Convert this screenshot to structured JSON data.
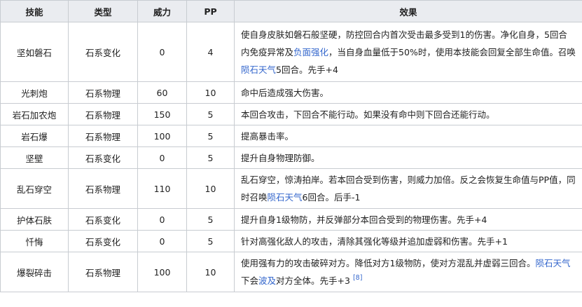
{
  "table": {
    "headers": [
      "技能",
      "类型",
      "威力",
      "PP",
      "效果"
    ],
    "rows": [
      {
        "name": "坚如磐石",
        "type": "石系变化",
        "power": "0",
        "pp": "4",
        "effect": [
          {
            "t": "使自身皮肤如磐石般坚硬，防控回合内首次受击最多受到1的伤害。净化自身，5回合内免疫异常及"
          },
          {
            "t": "负面强化",
            "link": true
          },
          {
            "t": "，当自身血量低于50%时，使用本技能会回复全部生命值。召唤"
          },
          {
            "t": "陨石天气",
            "link": true
          },
          {
            "t": "5回合。先手+4"
          }
        ]
      },
      {
        "name": "光刺炮",
        "type": "石系物理",
        "power": "60",
        "pp": "10",
        "effect": [
          {
            "t": "命中后造成强大伤害。"
          }
        ]
      },
      {
        "name": "岩石加农炮",
        "type": "石系物理",
        "power": "150",
        "pp": "5",
        "effect": [
          {
            "t": "本回合攻击，下回合不能行动。如果没有命中则下回合还能行动。"
          }
        ]
      },
      {
        "name": "岩石爆",
        "type": "石系物理",
        "power": "100",
        "pp": "5",
        "effect": [
          {
            "t": "提高暴击率。"
          }
        ]
      },
      {
        "name": "坚壁",
        "type": "石系变化",
        "power": "0",
        "pp": "5",
        "effect": [
          {
            "t": "提升自身物理防御。"
          }
        ]
      },
      {
        "name": "乱石穿空",
        "type": "石系物理",
        "power": "110",
        "pp": "10",
        "effect": [
          {
            "t": "乱石穿空，惊涛拍岸。若本回合受到伤害，则威力加倍。反之会恢复生命值与PP值，同时召唤"
          },
          {
            "t": "陨石天气",
            "link": true
          },
          {
            "t": "6回合。后手-1"
          }
        ]
      },
      {
        "name": "护体石肤",
        "type": "石系变化",
        "power": "0",
        "pp": "5",
        "effect": [
          {
            "t": "提升自身1级物防，并反弹部分本回合受到的物理伤害。先手+4"
          }
        ]
      },
      {
        "name": "忏悔",
        "type": "石系变化",
        "power": "0",
        "pp": "5",
        "effect": [
          {
            "t": "针对高强化敌人的攻击，清除其强化等级并追加虚弱和伤害。先手+1"
          }
        ]
      },
      {
        "name": "爆裂碎击",
        "type": "石系物理",
        "power": "100",
        "pp": "10",
        "effect": [
          {
            "t": "使用强有力的攻击破碎对方。降低对方1级物防，使对方混乱并虚弱三回合。"
          },
          {
            "t": "陨石天气",
            "link": true
          },
          {
            "t": "下会"
          },
          {
            "t": "波及",
            "link": true
          },
          {
            "t": "对方全体。先手+3 "
          },
          {
            "t": "[8]",
            "link": true,
            "sup": true
          }
        ]
      }
    ]
  },
  "colors": {
    "link": "#3366cc",
    "header_bg": "#eaecf0",
    "border": "#c8ccd1"
  }
}
